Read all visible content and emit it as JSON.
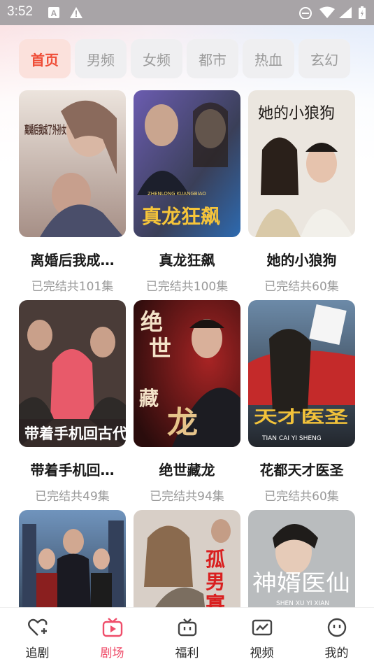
{
  "status_bar": {
    "time": "3:52"
  },
  "tabs": [
    {
      "label": "首页",
      "active": true
    },
    {
      "label": "男频",
      "active": false
    },
    {
      "label": "女频",
      "active": false
    },
    {
      "label": "都市",
      "active": false
    },
    {
      "label": "热血",
      "active": false
    },
    {
      "label": "玄幻",
      "active": false
    }
  ],
  "dramas": [
    {
      "title": "离婚后我成…",
      "episodes": "已完结共101集",
      "poster_text": "离婚后我成了外孙女",
      "palette": [
        "#e9ded6",
        "#a88f85"
      ]
    },
    {
      "title": "真龙狂飙",
      "episodes": "已完结共100集",
      "poster_text": "真龙狂飙",
      "poster_subtext": "ZHENLONG KUANGBIAO",
      "palette": [
        "#3a3f58",
        "#6e5fa8"
      ]
    },
    {
      "title": "她的小狼狗",
      "episodes": "已完结共60集",
      "poster_text": "她的小狼狗",
      "palette": [
        "#e7e3dc",
        "#b9a88f"
      ]
    },
    {
      "title": "带着手机回…",
      "episodes": "已完结共49集",
      "poster_text": "带着手机回古代",
      "palette": [
        "#3b3030",
        "#7b5a56"
      ]
    },
    {
      "title": "绝世藏龙",
      "episodes": "已完结共94集",
      "poster_text": "绝世藏龙",
      "palette": [
        "#3a1414",
        "#8b1f1f"
      ]
    },
    {
      "title": "花都天才医圣",
      "episodes": "已完结共60集",
      "poster_text": "花都天才医圣",
      "poster_subtext": "TIAN CAI YI SHENG",
      "palette": [
        "#3c4a5a",
        "#8a2b2b"
      ]
    },
    {
      "title": "",
      "episodes": "",
      "poster_text": "",
      "palette": [
        "#3f5a7a",
        "#1e2633"
      ]
    },
    {
      "title": "",
      "episodes": "",
      "poster_text": "孤男寡",
      "palette": [
        "#d8cfc7",
        "#a59281"
      ]
    },
    {
      "title": "",
      "episodes": "",
      "poster_text": "神婿医仙",
      "poster_subtext": "SHEN XU YI XIAN",
      "palette": [
        "#bfc2c4",
        "#3a3d40"
      ]
    }
  ],
  "bottom_nav": [
    {
      "label": "追剧",
      "icon": "heart-plus-icon",
      "active": false
    },
    {
      "label": "剧场",
      "icon": "tv-icon",
      "active": true
    },
    {
      "label": "福利",
      "icon": "gift-tv-icon",
      "active": false
    },
    {
      "label": "视频",
      "icon": "video-icon",
      "active": false
    },
    {
      "label": "我的",
      "icon": "profile-icon",
      "active": false
    }
  ],
  "colors": {
    "accent": "#ef4d37",
    "nav_active": "#ef4d6a",
    "muted": "#9a9a9a"
  }
}
